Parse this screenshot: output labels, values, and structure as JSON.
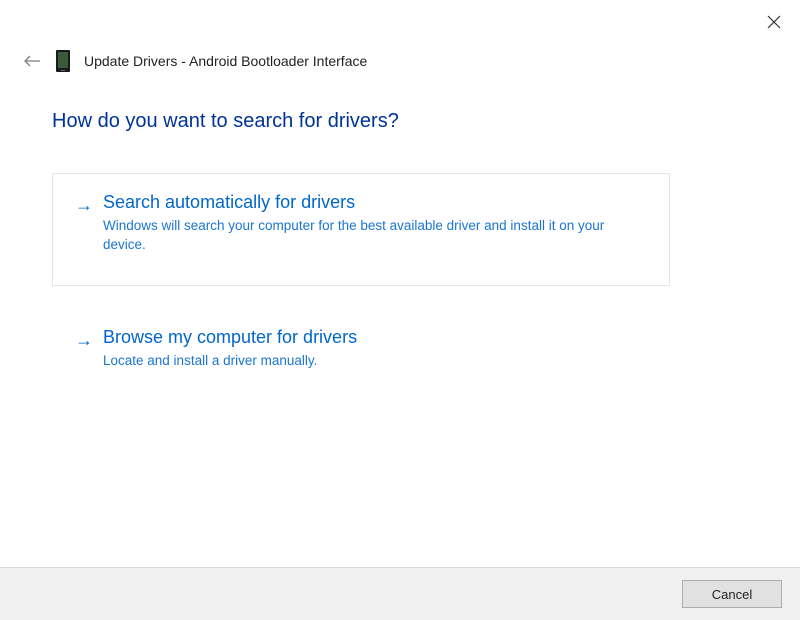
{
  "header": {
    "title": "Update Drivers - Android Bootloader Interface"
  },
  "main": {
    "question": "How do you want to search for drivers?",
    "options": [
      {
        "title": "Search automatically for drivers",
        "description": "Windows will search your computer for the best available driver and install it on your device."
      },
      {
        "title": "Browse my computer for drivers",
        "description": "Locate and install a driver manually."
      }
    ]
  },
  "footer": {
    "cancel_label": "Cancel"
  }
}
